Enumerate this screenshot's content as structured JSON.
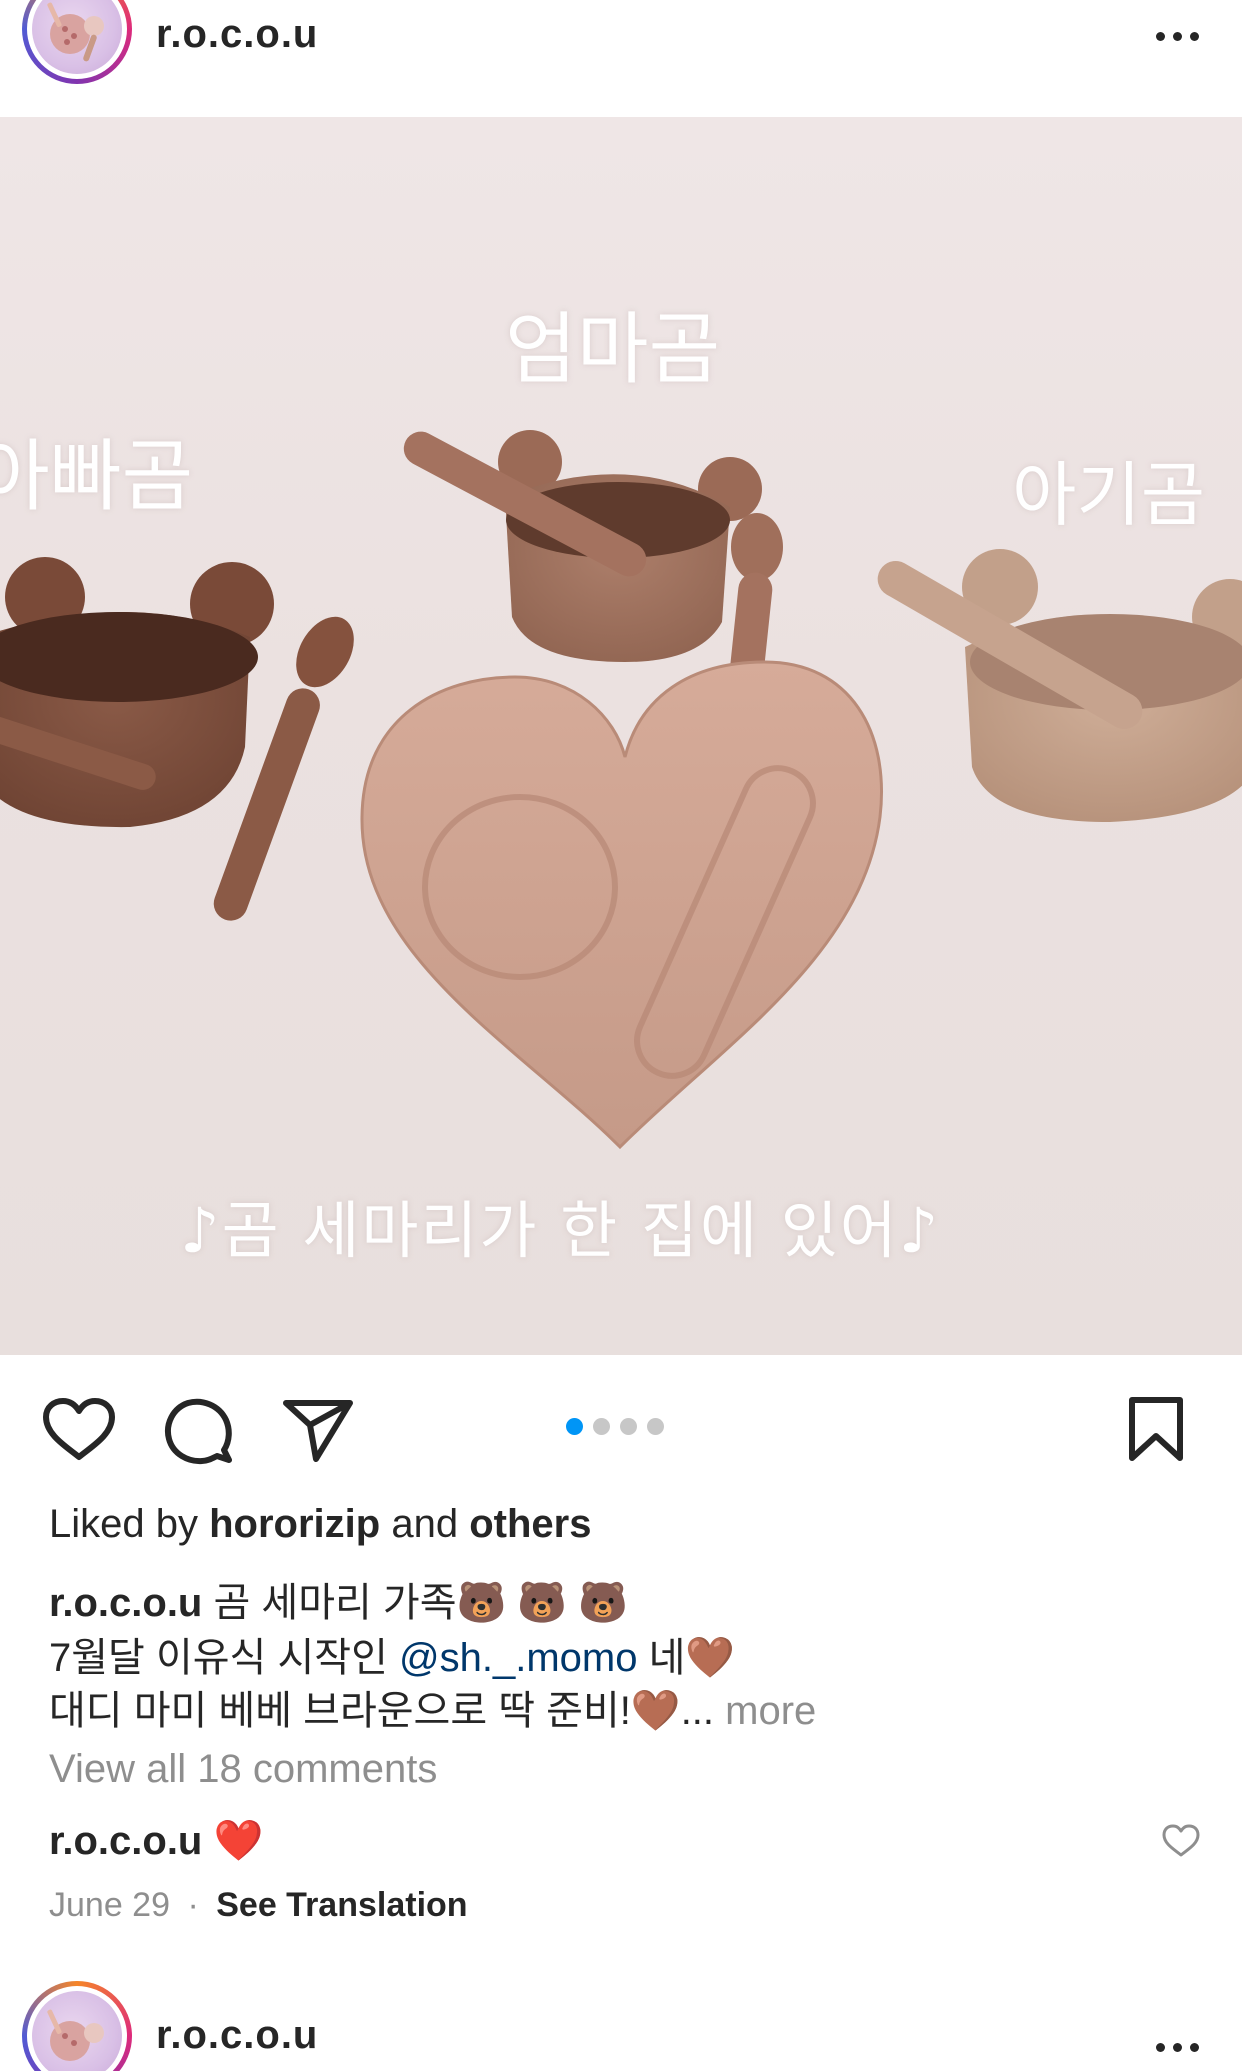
{
  "post": {
    "username": "r.o.c.o.u",
    "photo_labels": {
      "mom": "엄마곰",
      "dad": "아빠곰",
      "baby": "아기곰",
      "caption": "♪곰 세마리가 한 집에 있어♪"
    },
    "carousel": {
      "count": 4,
      "active_index": 0,
      "active_color": "#0095f6"
    },
    "likes": {
      "prefix": "Liked by",
      "user": "hororizip",
      "joiner": "and",
      "others": "others"
    },
    "caption": {
      "username": "r.o.c.o.u",
      "line1": "곰 세마리 가족🐻 🐻 🐻",
      "line2_a": "7월달 이유식 시작인",
      "mention": "@sh._.momo",
      "line2_b": "네🤎",
      "line3": "대디 마미 베베 브라운으로 딱 준비!🤎",
      "ellipsis": "...",
      "more": "more"
    },
    "view_comments": "View all 18 comments",
    "top_comment": {
      "username": "r.o.c.o.u",
      "text": "❤️"
    },
    "date": "June 29",
    "separator": "·",
    "see_translation": "See Translation"
  },
  "next_post": {
    "username": "r.o.c.o.u"
  },
  "icons": {
    "like": "heart-outline-icon",
    "comment": "comment-bubble-icon",
    "share": "paper-plane-icon",
    "save": "bookmark-icon",
    "more": "more-dots-icon",
    "comment_like": "small-heart-icon"
  }
}
